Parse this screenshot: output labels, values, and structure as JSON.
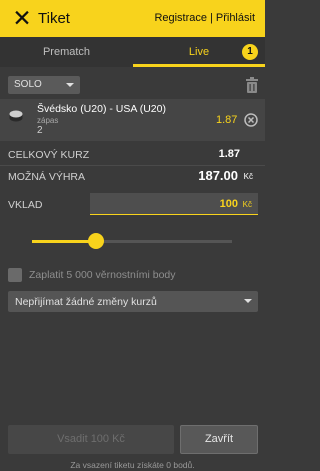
{
  "header": {
    "close_icon": "close-icon",
    "title": "Tiket",
    "register_label": "Registrace",
    "separator": "|",
    "login_label": "Přihlásit"
  },
  "tabs": [
    {
      "label": "Prematch",
      "active": false
    },
    {
      "label": "Live",
      "active": true,
      "badge": "1"
    }
  ],
  "ticket_type": {
    "selected": "SOLO"
  },
  "bet": {
    "match": "Švédsko (U20) - USA (U20)",
    "market": "zápas",
    "pick": "2",
    "odd": "1.87"
  },
  "summary": {
    "total_odds_label": "CELKOVÝ KURZ",
    "total_odds_value": "1.87",
    "possible_win_label": "MOŽNÁ VÝHRA",
    "possible_win_value": "187.00",
    "possible_win_currency": "Kč"
  },
  "stake": {
    "label": "VKLAD",
    "value": "100",
    "currency": "Kč",
    "slider_fraction": 0.32
  },
  "loyalty": {
    "label": "Zaplatit 5 000 věrnostními body",
    "checked": false
  },
  "odds_change": {
    "selected": "Nepřijímat žádné změny kurzů"
  },
  "actions": {
    "place_label": "Vsadit 100 Kč",
    "close_label": "Zavřít"
  },
  "footnote": "Za vsazení tiketu získáte 0 bodů.",
  "colors": {
    "accent": "#f8d31c",
    "background": "#3a3a3a"
  }
}
